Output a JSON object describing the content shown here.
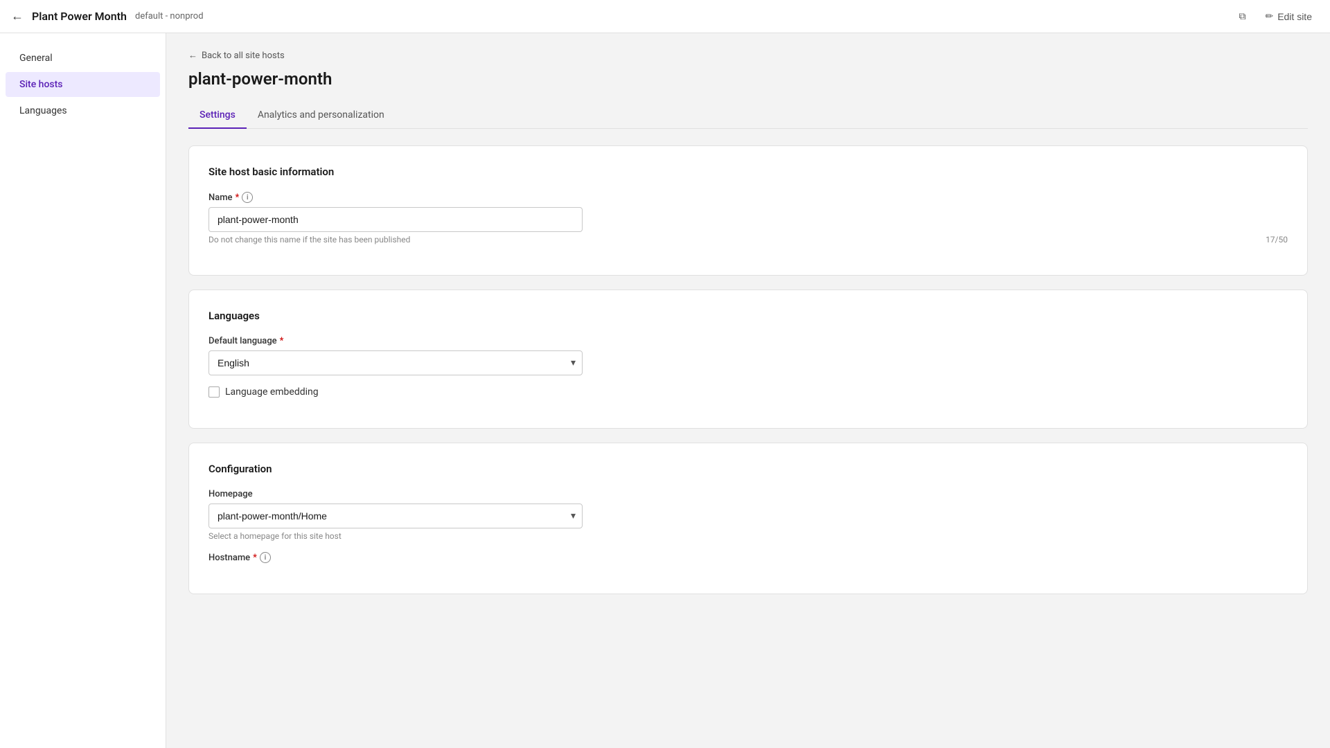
{
  "header": {
    "back_icon": "←",
    "title": "Plant Power Month",
    "env_label": "default - nonprod",
    "copy_icon": "⧉",
    "edit_label": "Edit site",
    "edit_icon": "✏"
  },
  "sidebar": {
    "items": [
      {
        "id": "general",
        "label": "General",
        "active": false
      },
      {
        "id": "site-hosts",
        "label": "Site hosts",
        "active": true
      },
      {
        "id": "languages",
        "label": "Languages",
        "active": false
      }
    ]
  },
  "main": {
    "back_link_icon": "←",
    "back_link_label": "Back to all site hosts",
    "page_title": "plant-power-month",
    "tabs": [
      {
        "id": "settings",
        "label": "Settings",
        "active": true
      },
      {
        "id": "analytics",
        "label": "Analytics and personalization",
        "active": false
      }
    ],
    "sections": {
      "basic_info": {
        "title": "Site host basic information",
        "name_label": "Name",
        "name_required": true,
        "name_info": true,
        "name_value": "plant-power-month",
        "name_hint": "Do not change this name if the site has been published",
        "name_char_count": "17/50"
      },
      "languages": {
        "title": "Languages",
        "default_language_label": "Default language",
        "default_language_required": true,
        "default_language_value": "English",
        "language_embedding_label": "Language embedding",
        "language_embedding_checked": false
      },
      "configuration": {
        "title": "Configuration",
        "homepage_label": "Homepage",
        "homepage_value": "plant-power-month/Home",
        "homepage_hint": "Select a homepage for this site host",
        "hostname_label": "Hostname"
      }
    }
  }
}
